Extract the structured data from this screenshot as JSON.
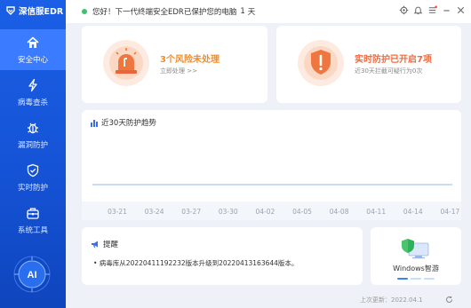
{
  "app": {
    "title": "深信服EDR"
  },
  "sidebar": {
    "items": [
      {
        "label": "安全中心",
        "icon": "home-icon",
        "active": true
      },
      {
        "label": "病毒查杀",
        "icon": "lightning-icon",
        "active": false
      },
      {
        "label": "漏洞防护",
        "icon": "bug-icon",
        "active": false
      },
      {
        "label": "实时防护",
        "icon": "shield-icon",
        "active": false
      },
      {
        "label": "系统工具",
        "icon": "toolbox-icon",
        "active": false
      }
    ],
    "ai_label": "AI"
  },
  "topbar": {
    "greeting": "您好！下一代终端安全EDR已保护您的电脑",
    "days": "1",
    "days_unit": "天",
    "icons": [
      "gear-icon",
      "bell-icon",
      "menu-icon",
      "minimize-icon",
      "close-icon"
    ]
  },
  "risk_card": {
    "title": "3个风险未处理",
    "subtitle": "立即处理 >>",
    "icon": "alarm-icon"
  },
  "protection_card": {
    "title": "实时防护已开启7项",
    "subtitle": "近30天拦截可疑行为0次",
    "icon": "shield-alert-icon"
  },
  "chart": {
    "title": "近30天防护趋势"
  },
  "chart_data": {
    "type": "line",
    "title": "近30天防护趋势",
    "categories": [
      "03-21",
      "03-24",
      "03-27",
      "03-30",
      "04-02",
      "04-05",
      "04-08",
      "04-11",
      "04-14",
      "04-17"
    ],
    "series": [
      {
        "values": [
          0,
          0,
          0,
          0,
          0,
          0,
          0,
          0,
          0,
          0
        ]
      }
    ],
    "grid": false
  },
  "notice": {
    "title": "提醒",
    "text": "• 病毒库从20220411192232版本升级到20220413163644版本。"
  },
  "windows_card": {
    "label": "Windows智游"
  },
  "footer": {
    "last_update": "上次更新：2022.04.1"
  },
  "colors": {
    "sidebar": "#1553d6",
    "active_nav": "#3a7bff",
    "risk_orange": "#f28c2c",
    "protection_red": "#f26b40",
    "status_green": "#3cc46b"
  }
}
